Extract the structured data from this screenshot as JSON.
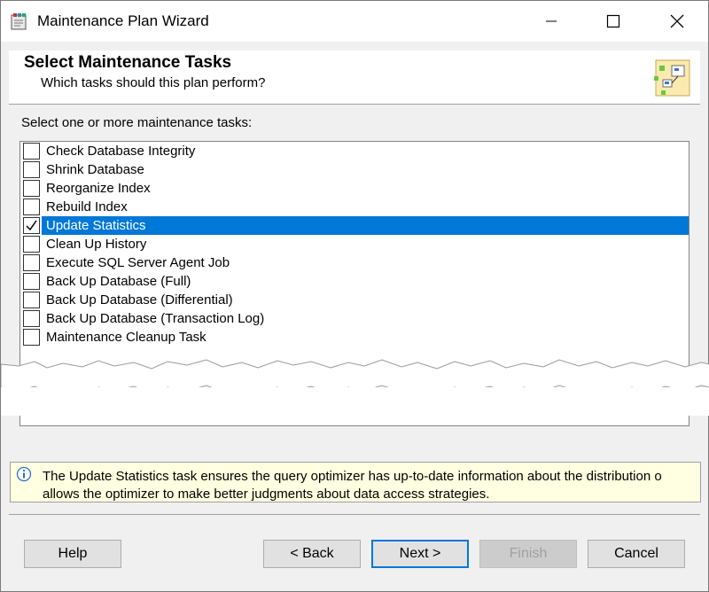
{
  "window": {
    "title": "Maintenance Plan Wizard"
  },
  "header": {
    "title": "Select Maintenance Tasks",
    "subtitle": "Which tasks should this plan perform?"
  },
  "prompt": "Select one or more maintenance tasks:",
  "tasks": [
    {
      "label": "Check Database Integrity",
      "checked": false,
      "selected": false
    },
    {
      "label": "Shrink Database",
      "checked": false,
      "selected": false
    },
    {
      "label": "Reorganize Index",
      "checked": false,
      "selected": false
    },
    {
      "label": "Rebuild Index",
      "checked": false,
      "selected": false
    },
    {
      "label": "Update Statistics",
      "checked": true,
      "selected": true
    },
    {
      "label": "Clean Up History",
      "checked": false,
      "selected": false
    },
    {
      "label": "Execute SQL Server Agent Job",
      "checked": false,
      "selected": false
    },
    {
      "label": "Back Up Database (Full)",
      "checked": false,
      "selected": false
    },
    {
      "label": "Back Up Database (Differential)",
      "checked": false,
      "selected": false
    },
    {
      "label": "Back Up Database (Transaction Log)",
      "checked": false,
      "selected": false
    },
    {
      "label": "Maintenance Cleanup Task",
      "checked": false,
      "selected": false
    }
  ],
  "info": {
    "icon": "info-icon",
    "line1": "The Update Statistics task ensures the query optimizer has up-to-date information about the distribution o",
    "line2": "allows the optimizer to make better judgments about data access strategies."
  },
  "buttons": {
    "help": "Help",
    "back": "< Back",
    "next": "Next >",
    "finish": "Finish",
    "cancel": "Cancel"
  },
  "colors": {
    "selection": "#0078d7",
    "info_background": "#ffffe1",
    "dialog_background": "#f0f0f0"
  }
}
